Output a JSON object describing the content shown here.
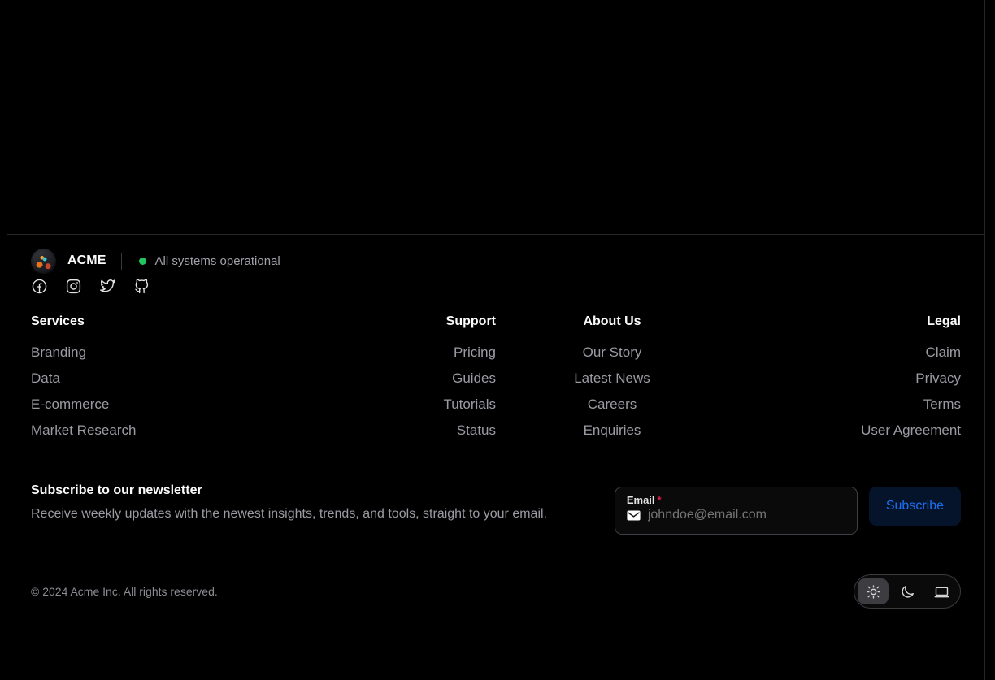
{
  "brand": {
    "logo_icon": "acme-logo-icon",
    "name": "ACME",
    "status_text": "All systems operational",
    "status_color": "#22c55e"
  },
  "social": [
    {
      "name": "facebook-icon",
      "label": "Facebook"
    },
    {
      "name": "instagram-icon",
      "label": "Instagram"
    },
    {
      "name": "twitter-icon",
      "label": "Twitter"
    },
    {
      "name": "github-icon",
      "label": "GitHub"
    }
  ],
  "columns": [
    {
      "heading": "Services",
      "links": [
        "Branding",
        "Data",
        "E-commerce",
        "Market Research"
      ]
    },
    {
      "heading": "Support",
      "links": [
        "Pricing",
        "Guides",
        "Tutorials",
        "Status"
      ]
    },
    {
      "heading": "About Us",
      "links": [
        "Our Story",
        "Latest News",
        "Careers",
        "Enquiries"
      ]
    },
    {
      "heading": "Legal",
      "links": [
        "Claim",
        "Privacy",
        "Terms",
        "User Agreement"
      ]
    }
  ],
  "newsletter": {
    "title": "Subscribe to our newsletter",
    "description": "Receive weekly updates with the newest insights, trends, and tools, straight to your email.",
    "email_label": "Email",
    "required_marker": "*",
    "email_placeholder": "johndoe@email.com",
    "email_value": "",
    "mail_icon": "envelope-icon",
    "submit_label": "Subscribe",
    "submit_bg": "#05142b",
    "submit_color": "#1d6ff0"
  },
  "bottom": {
    "copyright": "© 2024 Acme Inc. All rights reserved.",
    "theme_options": [
      {
        "name": "theme-light",
        "icon": "sun-icon",
        "selected": true
      },
      {
        "name": "theme-dark",
        "icon": "moon-icon",
        "selected": false
      },
      {
        "name": "theme-system",
        "icon": "monitor-icon",
        "selected": false
      }
    ]
  }
}
